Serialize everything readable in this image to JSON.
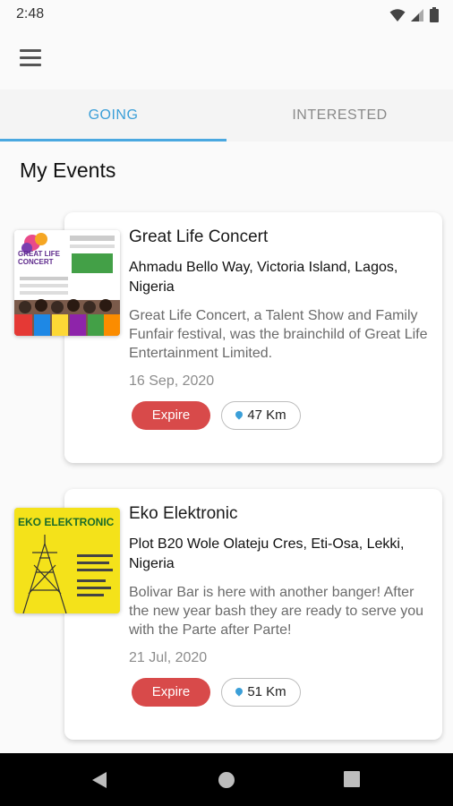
{
  "status_bar": {
    "time": "2:48"
  },
  "tabs": [
    {
      "label": "GOING"
    },
    {
      "label": "INTERESTED"
    }
  ],
  "section_title": "My Events",
  "events": [
    {
      "title": "Great Life Concert",
      "address": "Ahmadu Bello Way, Victoria Island, Lagos, Nigeria",
      "description": "Great Life Concert, a Talent Show and Family Funfair festival, was the brainchild of Great Life Entertainment Limited.",
      "date": "16 Sep, 2020",
      "status": "Expire",
      "distance": "47 Km",
      "poster_text": "GREAT LIFE CONCERT"
    },
    {
      "title": "Eko Elektronic",
      "address": "Plot B20 Wole Olateju Cres, Eti-Osa, Lekki, Nigeria",
      "description": "Bolivar Bar is here with another banger! After the new year bash they are ready to serve you with the Parte after Parte!",
      "date": "21 Jul, 2020",
      "status": "Expire",
      "distance": "51 Km",
      "poster_text": "EKO ELEKTRONIC"
    }
  ],
  "colors": {
    "accent": "#3b9fd8",
    "expire": "#d84a4a",
    "poster_yellow": "#f4e21a"
  },
  "icons": [
    "wifi-icon",
    "signal-icon",
    "battery-icon",
    "menu-icon",
    "location-pin-icon",
    "back-icon",
    "home-icon",
    "recents-icon"
  ]
}
